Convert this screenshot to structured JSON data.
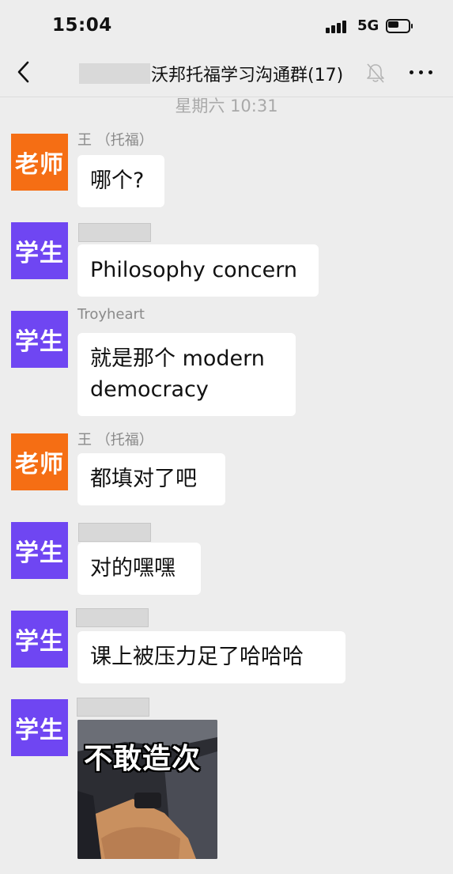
{
  "status_bar": {
    "time": "15:04",
    "network": "5G",
    "icons": [
      "signal-bars-icon",
      "battery-icon"
    ]
  },
  "nav": {
    "back_icon": "chevron-left-icon",
    "title": "沃邦托福学习沟通群(17)",
    "mute_icon": "bell-muted-icon",
    "more_icon": "ellipsis-icon"
  },
  "chat": {
    "timestamp": "星期六 10:31",
    "messages": [
      {
        "role": "teacher",
        "avatar_label": "老师",
        "sender": "王 （托福）",
        "text": "哪个?"
      },
      {
        "role": "student",
        "avatar_label": "学生",
        "sender": "",
        "text": "Philosophy concern"
      },
      {
        "role": "student",
        "avatar_label": "学生",
        "sender": "Troyheart",
        "text": "就是那个 modern democracy"
      },
      {
        "role": "teacher",
        "avatar_label": "老师",
        "sender": "王 （托福）",
        "text": "都填对了吧"
      },
      {
        "role": "student",
        "avatar_label": "学生",
        "sender": "",
        "text": "对的嘿嘿"
      },
      {
        "role": "student",
        "avatar_label": "学生",
        "sender": "",
        "text": "课上被压力足了哈哈哈"
      },
      {
        "role": "student",
        "avatar_label": "学生",
        "sender": "",
        "sticker_text": "不敢造次"
      }
    ]
  },
  "colors": {
    "background": "#ededed",
    "bubble": "#ffffff",
    "teacher_avatar": "#f56e14",
    "student_avatar": "#6f46f2",
    "secondary_text": "#a9a9a9"
  }
}
